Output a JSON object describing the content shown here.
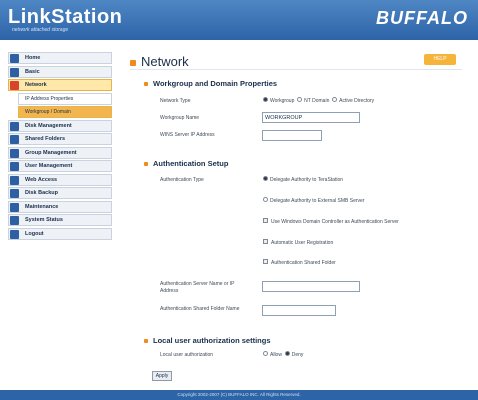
{
  "header": {
    "logo": "LinkStation",
    "logo_tagline": "network attached storage",
    "brand": "BUFFALO"
  },
  "sidebar": {
    "items": [
      {
        "label": "Home",
        "icon": "home-icon"
      },
      {
        "label": "Basic",
        "icon": "basic-icon"
      },
      {
        "label": "Network",
        "icon": "network-icon",
        "active": true
      },
      {
        "label": "IP Address Properties",
        "sub": true
      },
      {
        "label": "Workgroup / Domain",
        "sub": true,
        "active": true
      },
      {
        "label": "Disk Management",
        "icon": "disk-icon"
      },
      {
        "label": "Shared Folders",
        "icon": "folder-icon"
      },
      {
        "label": "Group Management",
        "icon": "group-icon"
      },
      {
        "label": "User Management",
        "icon": "user-icon"
      },
      {
        "label": "Web Access",
        "icon": "globe-icon"
      },
      {
        "label": "Disk Backup",
        "icon": "backup-icon"
      },
      {
        "label": "Maintenance",
        "icon": "wrench-icon"
      },
      {
        "label": "System Status",
        "icon": "status-icon"
      },
      {
        "label": "Logout",
        "icon": "logout-icon"
      }
    ]
  },
  "page": {
    "title": "Network",
    "help_label": "HELP"
  },
  "workgroup": {
    "heading": "Workgroup and Domain Properties",
    "network_type_label": "Network Type",
    "network_type_options": [
      "Workgroup",
      "NT Domain",
      "Active Directory"
    ],
    "network_type_selected": "Workgroup",
    "workgroup_name_label": "Workgroup Name",
    "workgroup_name_value": "WORKGROUP",
    "wins_label": "WINS Server IP Address",
    "wins_value": ""
  },
  "auth": {
    "heading": "Authentication Setup",
    "type_label": "Authentication Type",
    "option1": "Delegate Authority to TeraStation",
    "option2": "Delegate Authority to External SMB Server",
    "check1": "Use Windows Domain Controller as Authentication Server",
    "check2": "Automatic User Registration",
    "check3": "Authentication Shared Folder",
    "server_label": "Authentication Server Name or IP Address",
    "server_value": "",
    "folder_label": "Authentication Shared Folder Name",
    "folder_value": ""
  },
  "local_auth": {
    "heading": "Local user authorization settings",
    "label": "Local user authorization",
    "options": [
      "Allow",
      "Deny"
    ],
    "selected": "Deny"
  },
  "apply_label": "Apply",
  "footer": "Copyright 2002-2007 (C) BUFFALO INC. All Rights Reserved.",
  "colors": {
    "header_blue": "#2d64a8",
    "accent_orange": "#f08a1d",
    "active_nav": "#f3b54d"
  }
}
